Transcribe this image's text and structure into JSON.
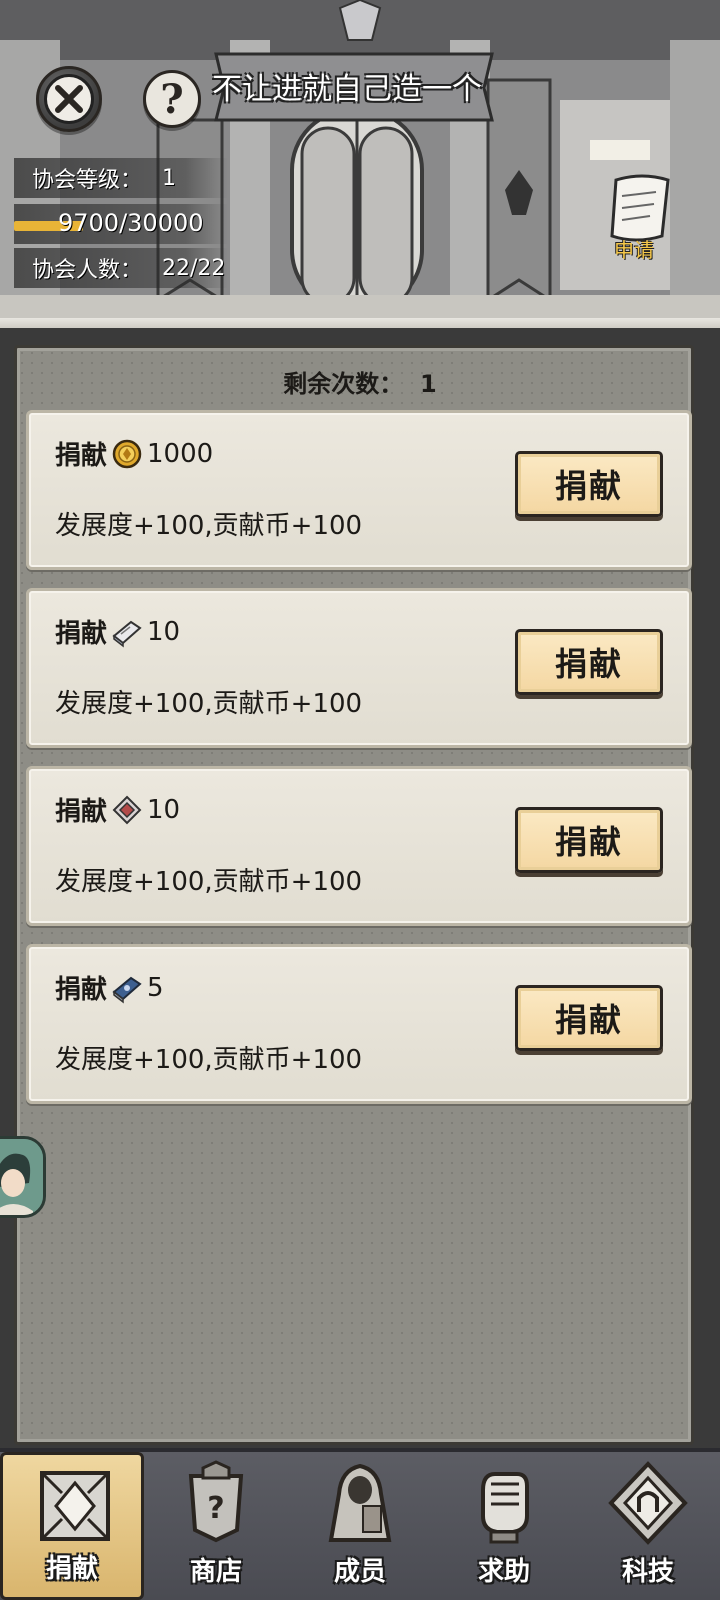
{
  "header": {
    "guild_name": "不让进就自己造一个",
    "level_label": "协会等级：",
    "level_value": "1",
    "exp_text": "9700/30000",
    "exp_progress": 0.3233,
    "members_label": "协会人数：",
    "members_value": "22/22",
    "apply_label": "申请",
    "close_icon": "close-icon",
    "help_icon": "question-icon"
  },
  "panel": {
    "remaining_label": "剩余次数：",
    "remaining_value": "1",
    "donations": [
      {
        "title": "捐献",
        "item_icon": "gold-coin-icon",
        "amount": "1000",
        "reward": "发展度+100,贡献币+100",
        "button": "捐献"
      },
      {
        "title": "捐献",
        "item_icon": "scroll-book-icon",
        "amount": "10",
        "reward": "发展度+100,贡献币+100",
        "button": "捐献"
      },
      {
        "title": "捐献",
        "item_icon": "gem-stone-icon",
        "amount": "10",
        "reward": "发展度+100,贡献币+100",
        "button": "捐献"
      },
      {
        "title": "捐献",
        "item_icon": "blue-tome-icon",
        "amount": "5",
        "reward": "发展度+100,贡献币+100",
        "button": "捐献"
      }
    ]
  },
  "nav": {
    "tabs": [
      {
        "label": "捐献",
        "icon": "donate-icon",
        "active": true
      },
      {
        "label": "商店",
        "icon": "shop-icon",
        "active": false
      },
      {
        "label": "成员",
        "icon": "members-icon",
        "active": false
      },
      {
        "label": "求助",
        "icon": "help-fist-icon",
        "active": false
      },
      {
        "label": "科技",
        "icon": "tech-icon",
        "active": false
      }
    ]
  },
  "colors": {
    "accent_gold": "#e8b437",
    "button_fill": "#f4d7a2",
    "panel_bg": "#8e8d86",
    "card_bg": "#e6e2d7",
    "nav_bg": "#53545b"
  }
}
